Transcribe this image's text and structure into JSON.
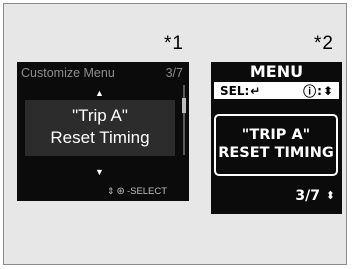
{
  "markers": {
    "star1": "*1",
    "star2": "*2"
  },
  "display1": {
    "title": "Customize Menu",
    "page": "3/7",
    "up_arrow": "▲",
    "line1": "\"Trip A\"",
    "line2": "Reset Timing",
    "down_arrow": "▼",
    "footer_updown": "⇕",
    "footer_dial": "⊛",
    "footer_label": "-SELECT"
  },
  "display2": {
    "menu": "MENU",
    "sel_label": "SEL:",
    "sel_icon": "↵",
    "info_icon": "ⓘ",
    "info_sep": ":",
    "info_arrows": "⬍",
    "line1": "\"TRIP A\"",
    "line2": "RESET TIMING",
    "page": "3/7",
    "page_arrows": "⬍"
  }
}
